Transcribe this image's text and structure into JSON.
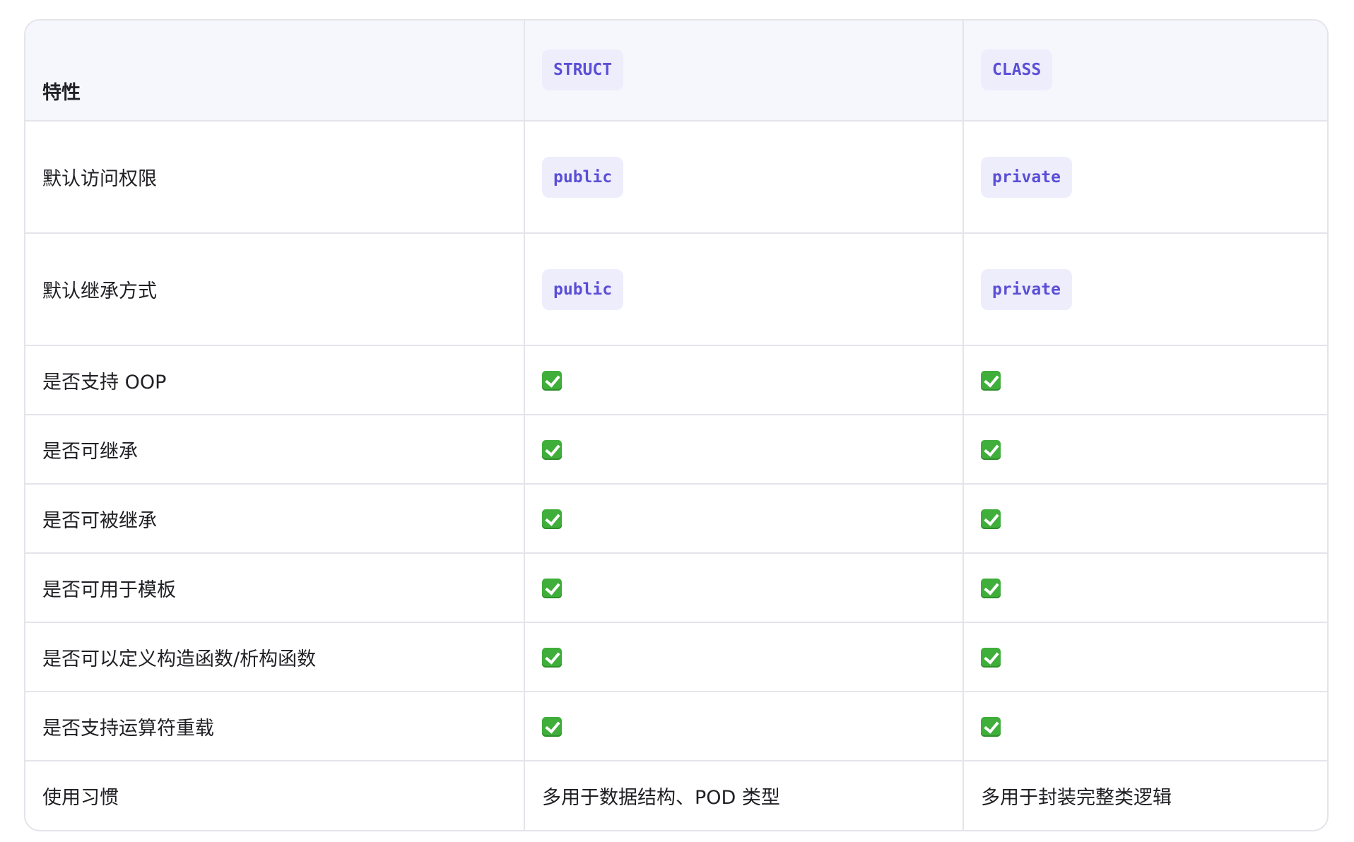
{
  "header": {
    "feature": "特性",
    "struct": "STRUCT",
    "class": "CLASS"
  },
  "rows": [
    {
      "feature": "默认访问权限",
      "struct": "public",
      "class": "private"
    },
    {
      "feature": "默认继承方式",
      "struct": "public",
      "class": "private"
    },
    {
      "feature": "是否支持 OOP",
      "struct": "✅",
      "class": "✅"
    },
    {
      "feature": "是否可继承",
      "struct": "✅",
      "class": "✅"
    },
    {
      "feature": "是否可被继承",
      "struct": "✅",
      "class": "✅"
    },
    {
      "feature": "是否可用于模板",
      "struct": "✅",
      "class": "✅"
    },
    {
      "feature": "是否可以定义构造函数/析构函数",
      "struct": "✅",
      "class": "✅"
    },
    {
      "feature": "是否支持运算符重载",
      "struct": "✅",
      "class": "✅"
    },
    {
      "feature": "使用习惯",
      "struct": "多用于数据结构、POD 类型",
      "class": "多用于封装完整类逻辑"
    }
  ],
  "icons": {
    "check": "check-mark-icon"
  },
  "colors": {
    "tag_bg": "#eeedfc",
    "tag_text": "#5a4fd6",
    "check_green": "#3fae3a",
    "header_bg": "#f6f7fc",
    "border": "#e4e4ea"
  }
}
